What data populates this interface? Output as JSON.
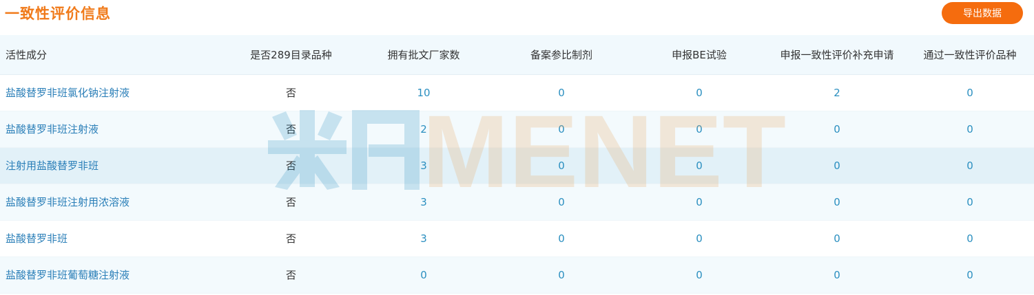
{
  "header": {
    "title": "一致性评价信息",
    "export_label": "导出数据"
  },
  "table": {
    "columns": [
      "活性成分",
      "是否289目录品种",
      "拥有批文厂家数",
      "备案参比制剂",
      "申报BE试验",
      "申报一致性评价补充申请",
      "通过一致性评价品种"
    ],
    "rows": [
      {
        "name": "盐酸替罗非班氯化钠注射液",
        "in_289": "否",
        "approved_makers": "10",
        "ref_filed": "0",
        "be_trial": "0",
        "supplement": "2",
        "passed": "0"
      },
      {
        "name": "盐酸替罗非班注射液",
        "in_289": "否",
        "approved_makers": "2",
        "ref_filed": "0",
        "be_trial": "0",
        "supplement": "0",
        "passed": "0"
      },
      {
        "name": "注射用盐酸替罗非班",
        "in_289": "否",
        "approved_makers": "3",
        "ref_filed": "0",
        "be_trial": "0",
        "supplement": "0",
        "passed": "0"
      },
      {
        "name": "盐酸替罗非班注射用浓溶液",
        "in_289": "否",
        "approved_makers": "3",
        "ref_filed": "0",
        "be_trial": "0",
        "supplement": "0",
        "passed": "0"
      },
      {
        "name": "盐酸替罗非班",
        "in_289": "否",
        "approved_makers": "3",
        "ref_filed": "0",
        "be_trial": "0",
        "supplement": "0",
        "passed": "0"
      },
      {
        "name": "盐酸替罗非班葡萄糖注射液",
        "in_289": "否",
        "approved_makers": "0",
        "ref_filed": "0",
        "be_trial": "0",
        "supplement": "0",
        "passed": "0"
      }
    ]
  },
  "watermark": {
    "text": "MENET",
    "colors": {
      "blue": "#2b8fc0",
      "orange": "#e8a25a"
    }
  },
  "colors": {
    "accent": "#f56c0e",
    "title": "#f07a1a",
    "link": "#2b7fb8"
  }
}
